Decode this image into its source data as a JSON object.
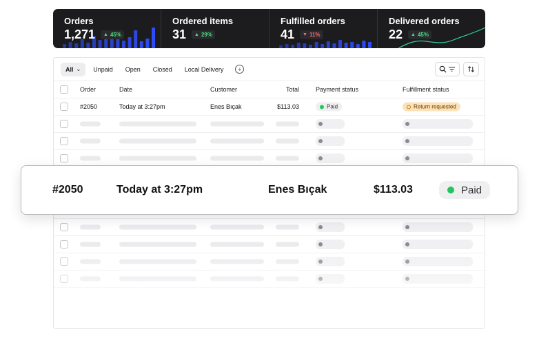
{
  "stats": [
    {
      "title": "Orders",
      "value": "1,271",
      "change": "45%",
      "trend": "up",
      "chart": "bars"
    },
    {
      "title": "Ordered items",
      "value": "31",
      "change": "29%",
      "trend": "up",
      "chart": "none"
    },
    {
      "title": "Fulfilled orders",
      "value": "41",
      "change": "11%",
      "trend": "down",
      "chart": "bars"
    },
    {
      "title": "Delivered orders",
      "value": "22",
      "change": "45%",
      "trend": "up",
      "chart": "line"
    }
  ],
  "filters": [
    {
      "label": "All",
      "active": true
    },
    {
      "label": "Unpaid",
      "active": false
    },
    {
      "label": "Open",
      "active": false
    },
    {
      "label": "Closed",
      "active": false
    },
    {
      "label": "Local Delivery",
      "active": false
    }
  ],
  "columns": {
    "order": "Order",
    "date": "Date",
    "customer": "Customer",
    "total": "Total",
    "payment": "Payment status",
    "fulfillment": "Fulfillment status"
  },
  "order": {
    "number": "#2050",
    "date": "Today at 3:27pm",
    "customer": "Enes Bıçak",
    "total": "$113.03",
    "payment": "Paid",
    "fulfillment": "Return requested"
  },
  "placeholder_rows": 10,
  "icons": {
    "add": "plus-circle-icon",
    "search": "search-icon",
    "filter": "filter-lines-icon",
    "sort": "sort-arrows-icon"
  },
  "colors": {
    "card_bg": "#1c1c1e",
    "accent_blue": "#2f4dff",
    "accent_green": "#22c55e",
    "trend_down": "#f87171",
    "return_badge": "#fde2b8"
  }
}
